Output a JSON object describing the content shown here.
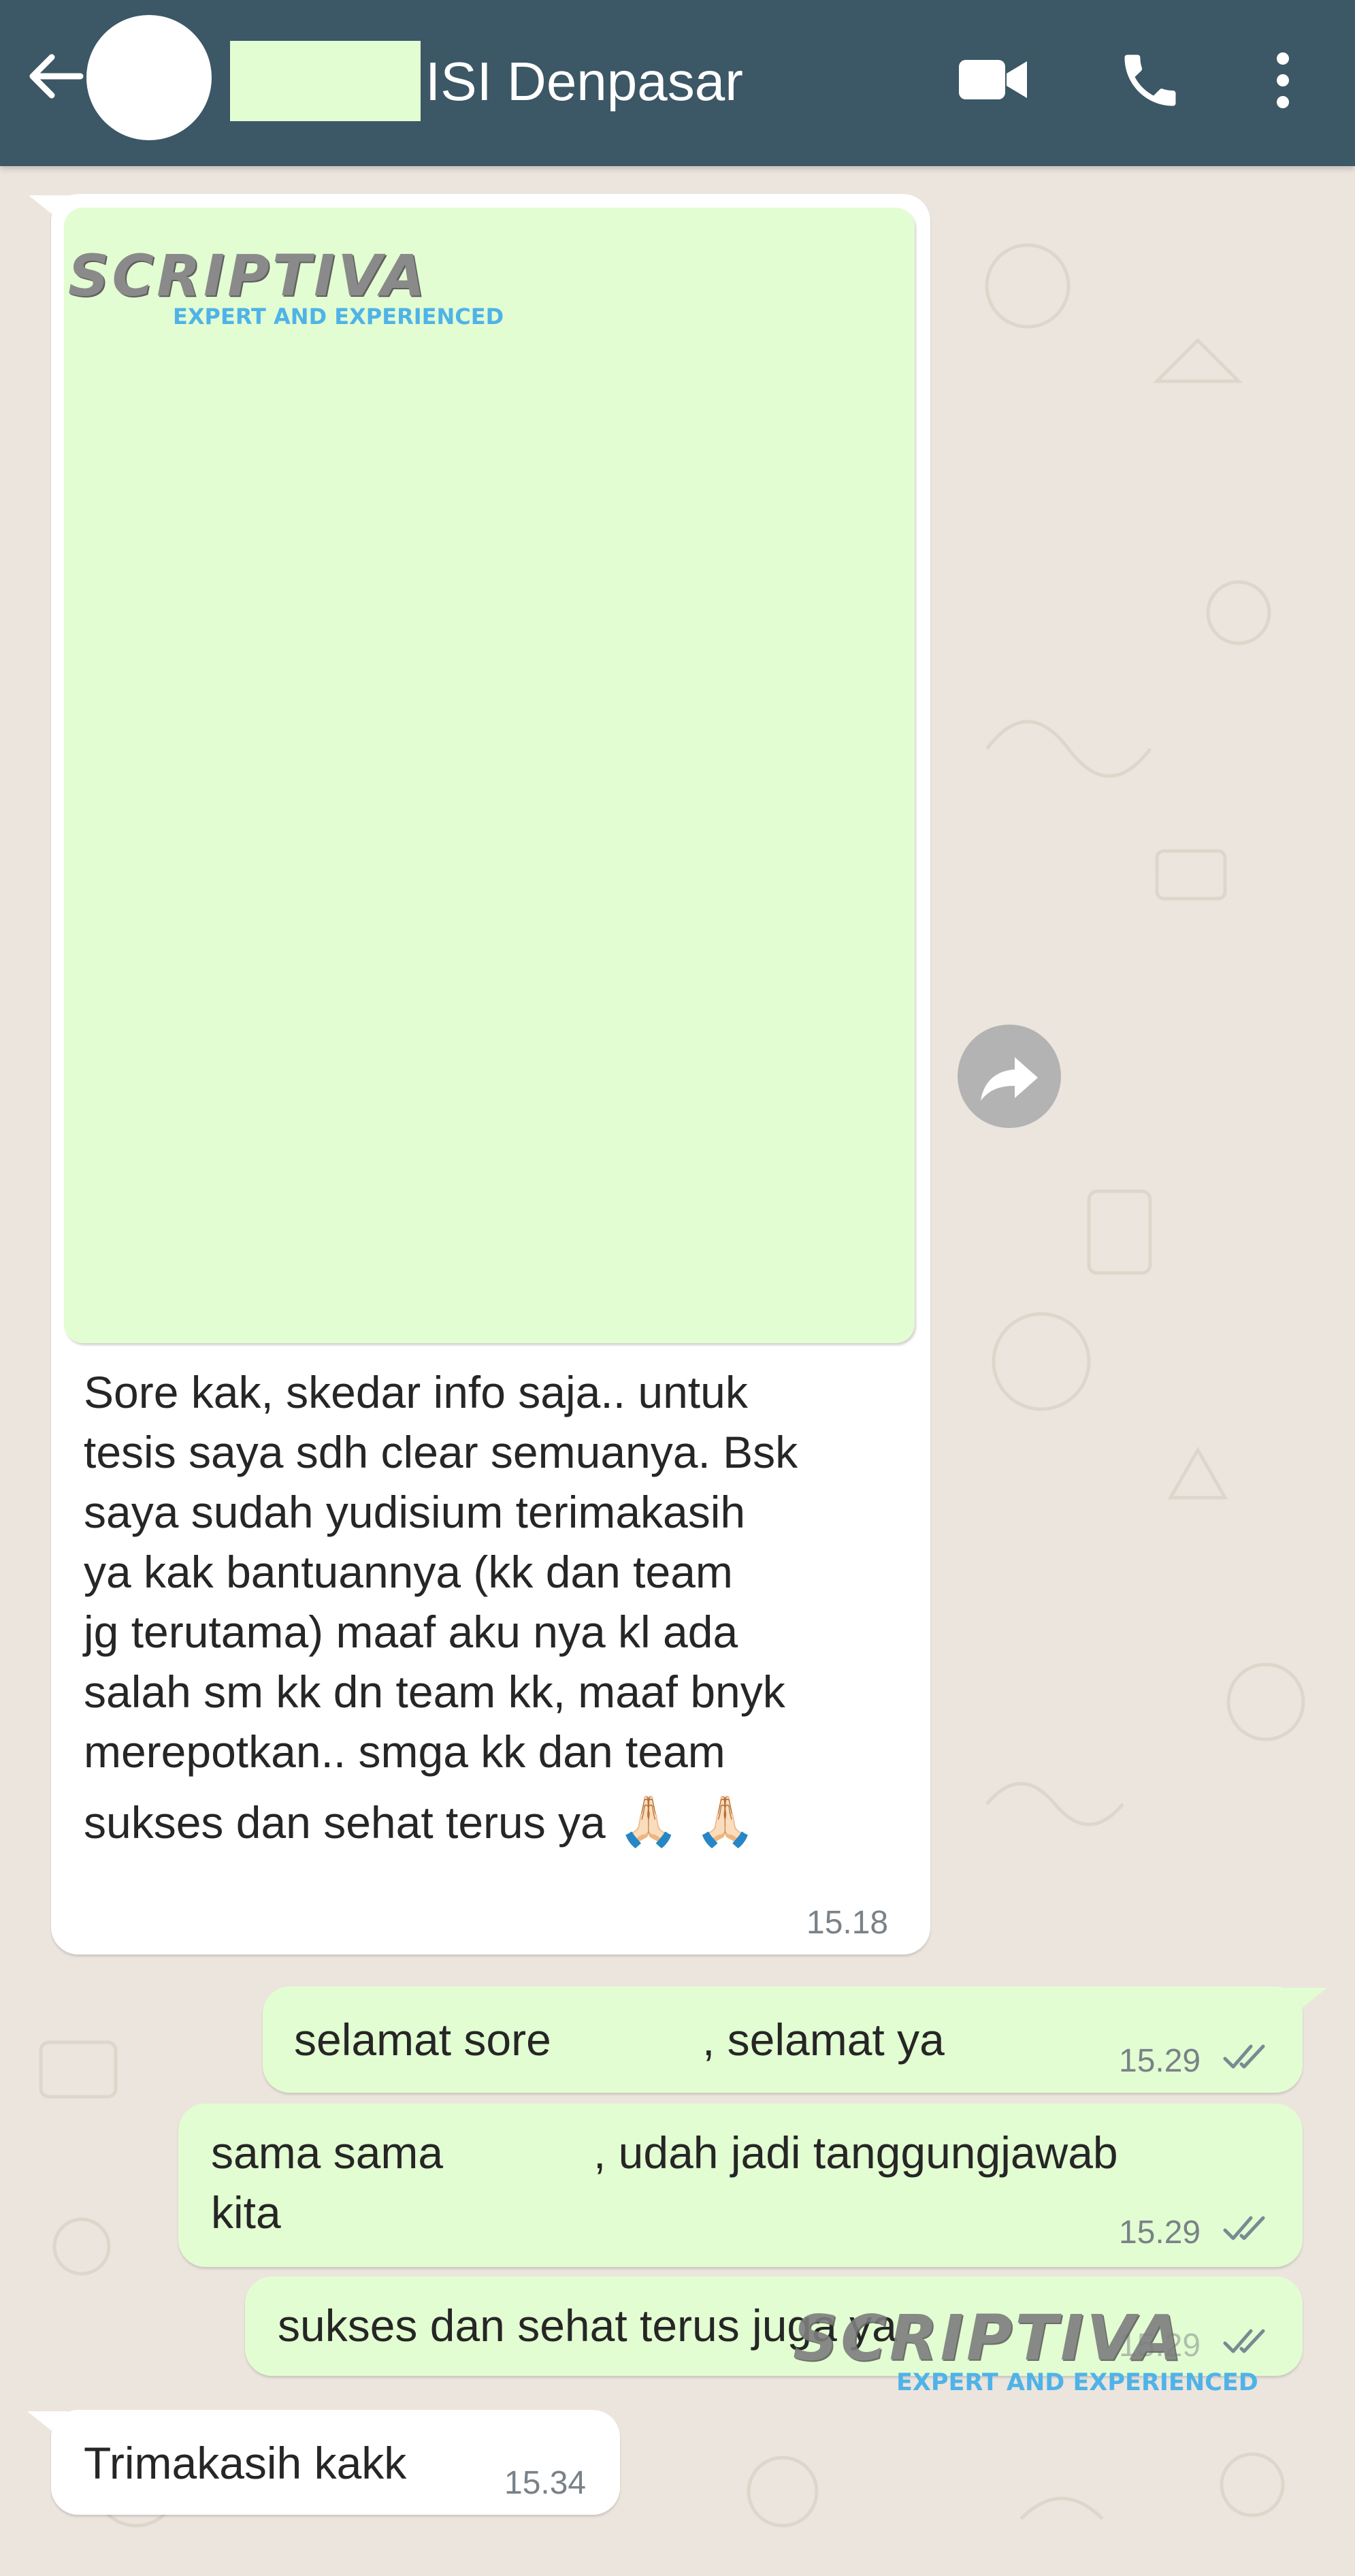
{
  "header": {
    "title": "ISI Denpasar"
  },
  "messages": [
    {
      "direction": "incoming",
      "has_media": true,
      "media_watermark": {
        "brand": "SCRIPTIVA",
        "tagline": "EXPERT AND EXPERIENCED"
      },
      "lines": [
        "Sore kak, skedar info saja.. untuk",
        "tesis saya sdh clear semuanya. Bsk",
        "saya sudah yudisium terimakasih",
        "ya kak bantuannya (kk dan team",
        "jg terutama) maaf aku nya kl ada",
        "salah sm kk dn team kk, maaf bnyk",
        "merepotkan.. smga kk dan team",
        "sukses dan sehat terus ya"
      ],
      "emoji": "🙏🏻 🙏🏻",
      "time": "15.18"
    },
    {
      "direction": "outgoing",
      "text_a": "selamat sore",
      "text_b": ", selamat ya",
      "time": "15.29",
      "status": "read"
    },
    {
      "direction": "outgoing",
      "text_a": "sama sama",
      "text_b": ", udah jadi tanggungjawab",
      "text_c": "kita",
      "time": "15.29",
      "status": "read"
    },
    {
      "direction": "outgoing",
      "text": "sukses dan sehat terus juga ya",
      "time": "15.29",
      "status": "read"
    },
    {
      "direction": "incoming",
      "text": "Trimakasih kakk",
      "time": "15.34"
    }
  ],
  "watermark": {
    "brand": "SCRIPTIVA",
    "tagline": "EXPERT AND EXPERIENCED"
  },
  "colors": {
    "header_bg": "#3c5766",
    "chat_bg": "#ece5dd",
    "outgoing_bubble": "#e3fdd2",
    "incoming_bubble": "#ffffff",
    "read_ticks": "#7a8a93",
    "watermark_blue": "#4fb3e8"
  },
  "icons": {
    "back": "arrow-left-icon",
    "video": "video-camera-icon",
    "call": "phone-icon",
    "menu": "more-vertical-icon",
    "forward": "forward-share-icon",
    "read": "double-check-icon"
  }
}
